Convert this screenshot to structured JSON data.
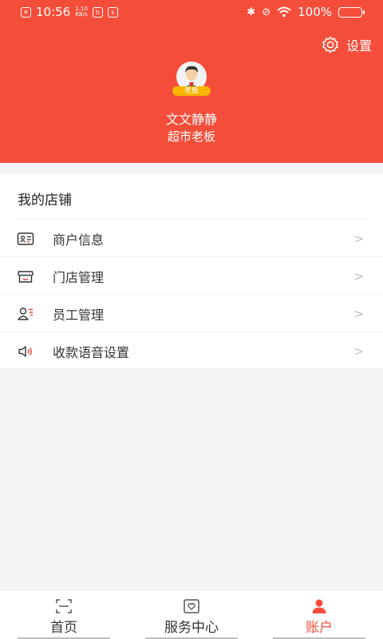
{
  "status_bar": {
    "time": "10:56",
    "speed_value": "1.10",
    "speed_unit": "KB/s",
    "battery_percent": "100%",
    "battery_level": 1.0
  },
  "header": {
    "settings_label": "设置",
    "avatar_badge": "老板",
    "user_name": "文文静静",
    "user_role": "超市老板",
    "background_color": "#f44e3b"
  },
  "store": {
    "section_title": "我的店铺",
    "items": [
      {
        "label": "商户信息",
        "icon": "merchant-card-icon"
      },
      {
        "label": "门店管理",
        "icon": "storefront-icon"
      },
      {
        "label": "员工管理",
        "icon": "staff-icon"
      },
      {
        "label": "收款语音设置",
        "icon": "speaker-icon"
      }
    ],
    "chevron": ">"
  },
  "tabbar": {
    "tabs": [
      {
        "label": "首页",
        "icon": "scan-icon",
        "active": false
      },
      {
        "label": "服务中心",
        "icon": "service-icon",
        "active": false
      },
      {
        "label": "账户",
        "icon": "account-icon",
        "active": true
      }
    ],
    "accent_color": "#f44e3b"
  }
}
